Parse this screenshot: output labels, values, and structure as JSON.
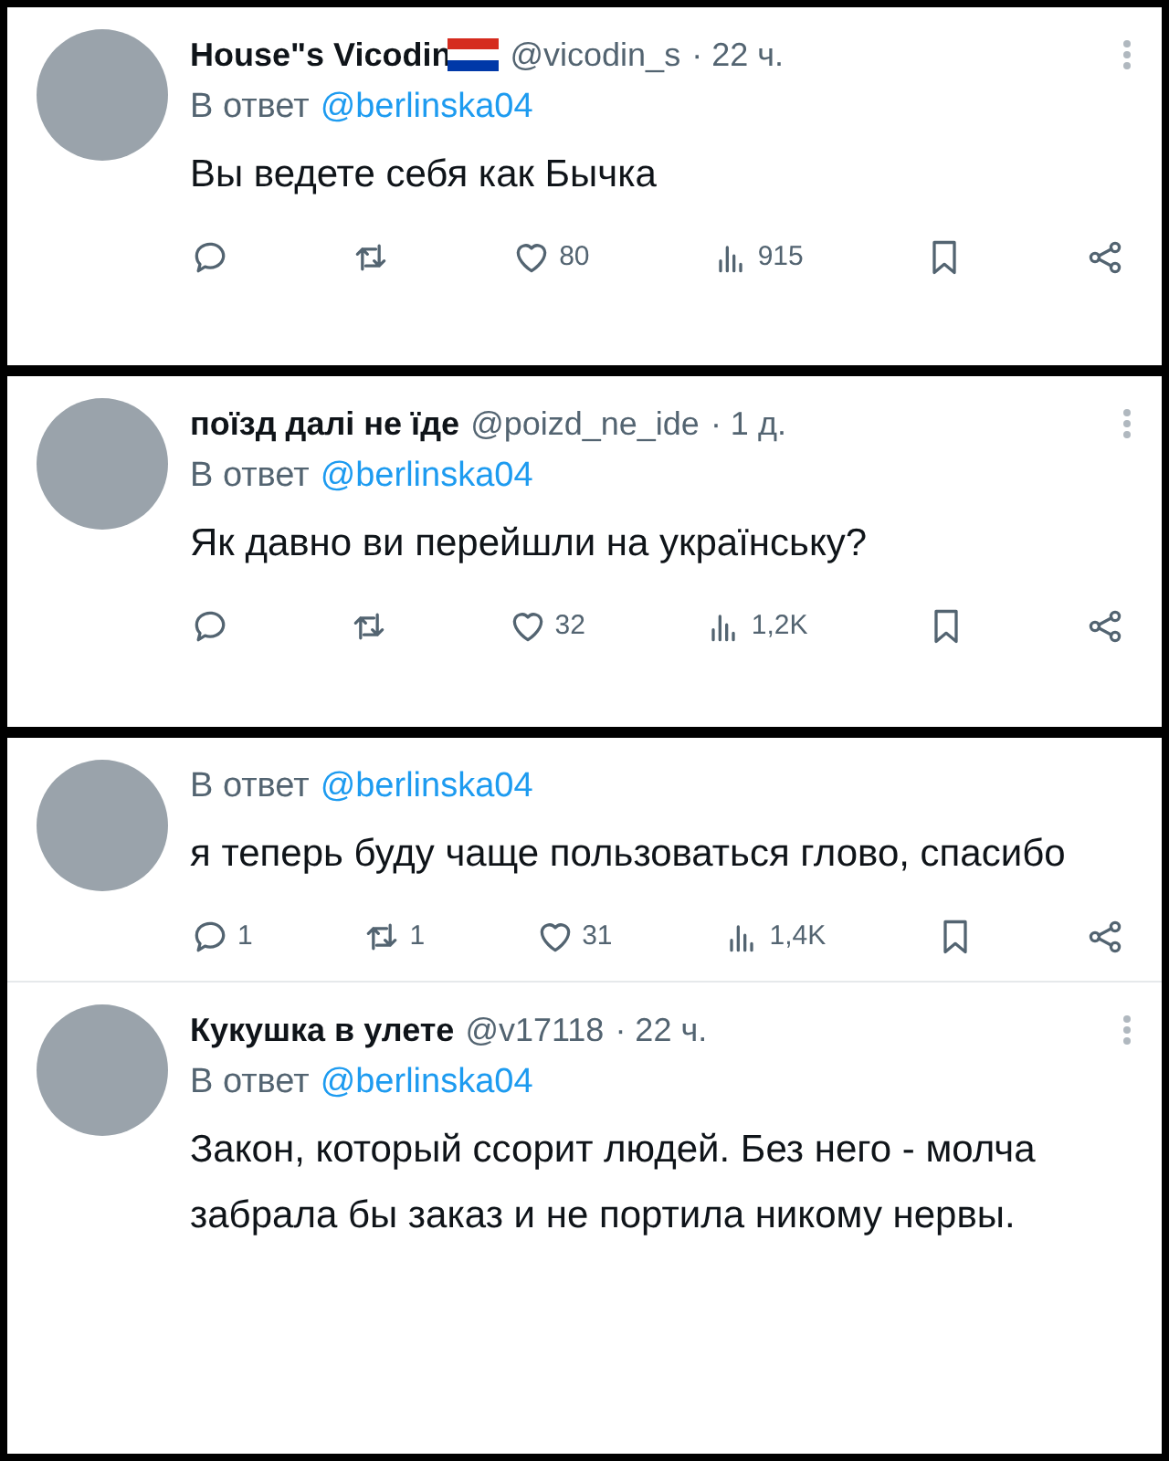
{
  "panels": [
    {
      "tweets": [
        {
          "name": "House\"s Vicodin",
          "flag": true,
          "handle": "@vicodin_s",
          "time": "· 22 ч.",
          "reply_prefix": "В ответ",
          "reply_to": "@berlinska04",
          "text": "Вы ведете себя как Бычка",
          "actions": [
            {
              "kind": "reply"
            },
            {
              "kind": "retweet"
            },
            {
              "kind": "like",
              "count": "80"
            },
            {
              "kind": "views",
              "count": "915"
            },
            {
              "kind": "bookmark"
            },
            {
              "kind": "share"
            }
          ]
        }
      ]
    },
    {
      "tweets": [
        {
          "name": "поїзд далі не їде",
          "flag": false,
          "handle": "@poizd_ne_ide",
          "time": "· 1 д.",
          "reply_prefix": "В ответ",
          "reply_to": "@berlinska04",
          "text": "Як давно ви перейшли на українську?",
          "actions": [
            {
              "kind": "reply"
            },
            {
              "kind": "retweet"
            },
            {
              "kind": "like",
              "count": "32"
            },
            {
              "kind": "views",
              "count": "1,2K"
            },
            {
              "kind": "bookmark"
            },
            {
              "kind": "share"
            }
          ]
        }
      ]
    },
    {
      "tweets": [
        {
          "reply_prefix": "В ответ",
          "reply_to": "@berlinska04",
          "text": "я теперь буду чаще пользоваться глово, спасибо",
          "actions": [
            {
              "kind": "reply",
              "count": "1"
            },
            {
              "kind": "retweet",
              "count": "1"
            },
            {
              "kind": "like",
              "count": "31"
            },
            {
              "kind": "views",
              "count": "1,4K"
            },
            {
              "kind": "bookmark"
            },
            {
              "kind": "share"
            }
          ]
        },
        {
          "name": "Кукушка в улете",
          "flag": false,
          "handle": "@v17118",
          "time": "· 22 ч.",
          "reply_prefix": "В ответ",
          "reply_to": "@berlinska04",
          "text": "Закон, который ссорит людей. Без него -  молча забрала бы заказ и не портила никому нервы."
        }
      ]
    }
  ]
}
